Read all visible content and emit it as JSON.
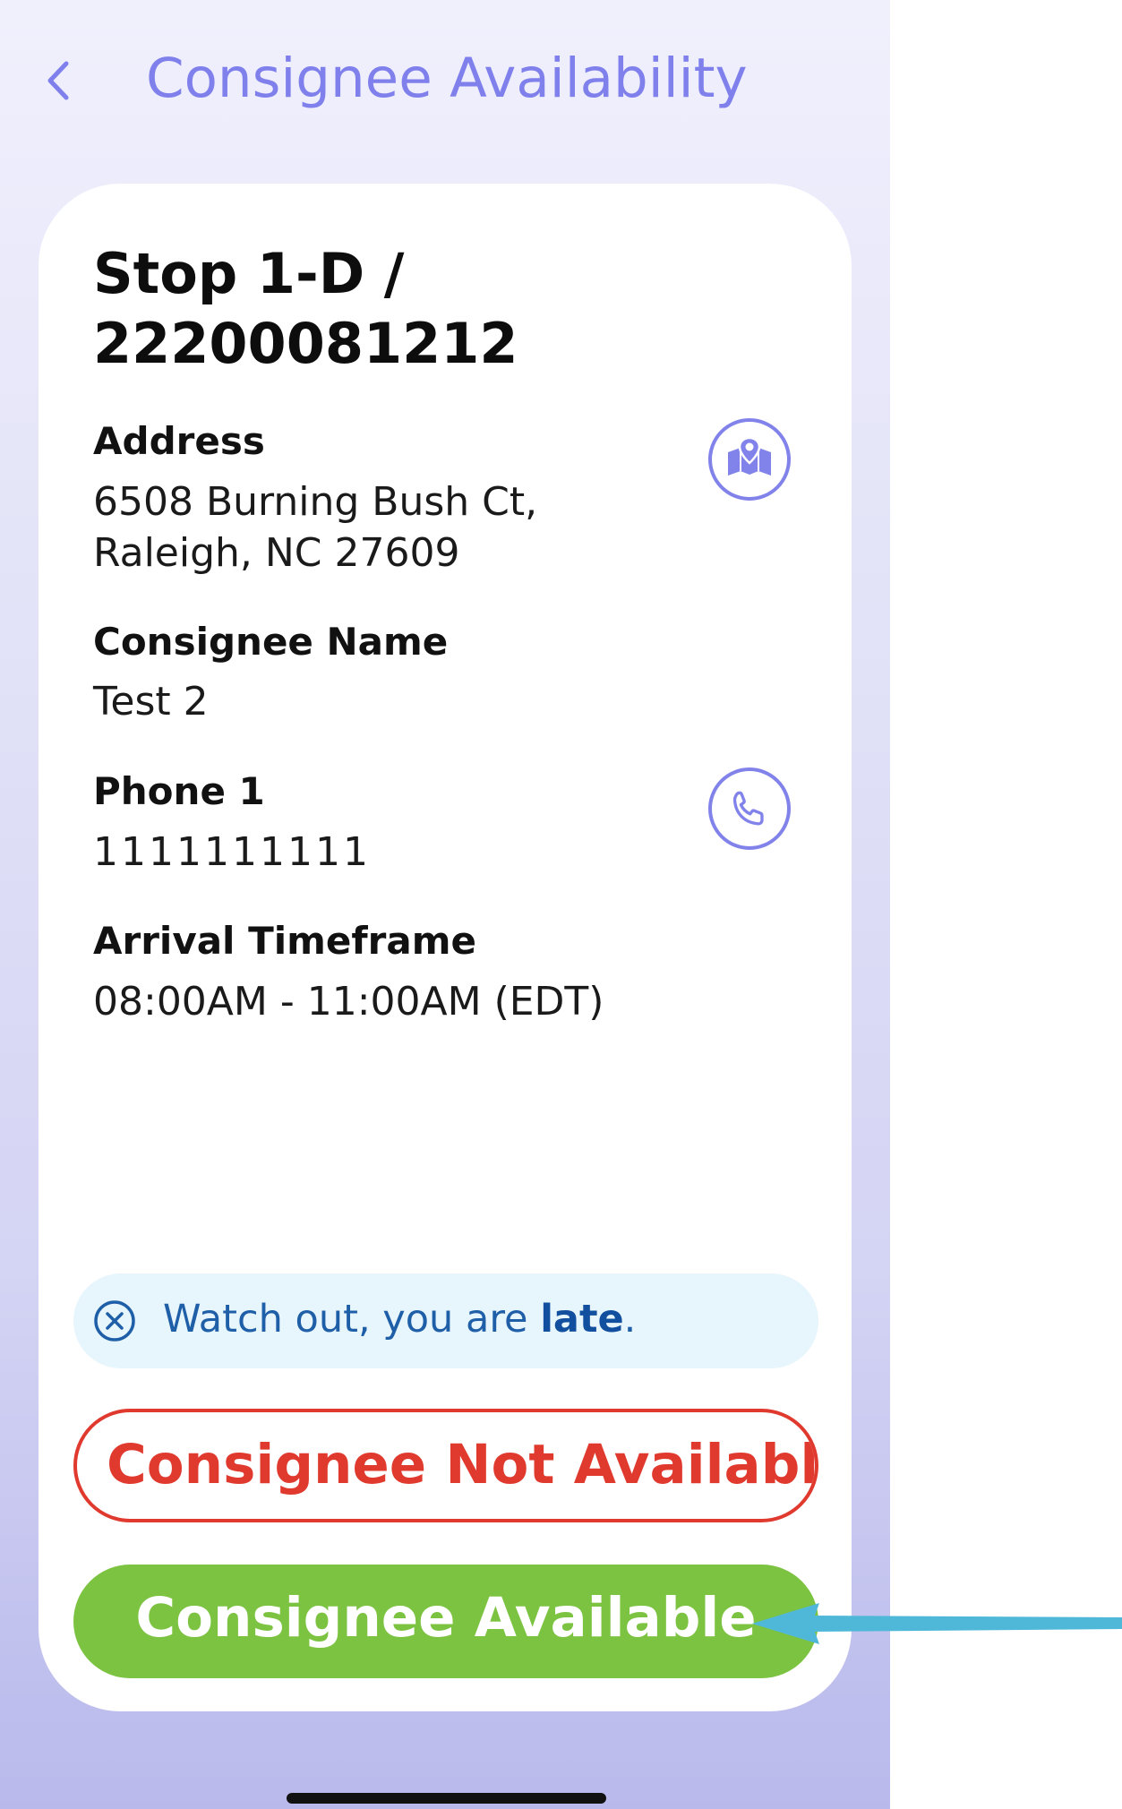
{
  "header": {
    "title": "Consignee Availability"
  },
  "card": {
    "stop_title": "Stop 1-D / 22200081212",
    "address": {
      "label": "Address",
      "value": "6508 Burning Bush Ct, Raleigh, NC 27609",
      "icon": "map-icon"
    },
    "consignee_name": {
      "label": "Consignee Name",
      "value": "Test 2"
    },
    "phone": {
      "label": "Phone 1",
      "value": "1111111111",
      "icon": "phone-icon"
    },
    "arrival": {
      "label": "Arrival Timeframe",
      "value": "08:00AM - 11:00AM (EDT)"
    }
  },
  "alert": {
    "text_prefix": "Watch out, you are ",
    "text_strong": "late",
    "text_suffix": ".",
    "icon": "close-circle-icon"
  },
  "buttons": {
    "not_available": "Consignee Not Available",
    "available": "Consignee Available"
  },
  "colors": {
    "accent": "#7f80ec",
    "danger": "#e03a2f",
    "success": "#7cc341",
    "info_bg": "#e7f5fd",
    "info_text": "#1f5fa8",
    "annotation_arrow": "#4fb8d8"
  }
}
